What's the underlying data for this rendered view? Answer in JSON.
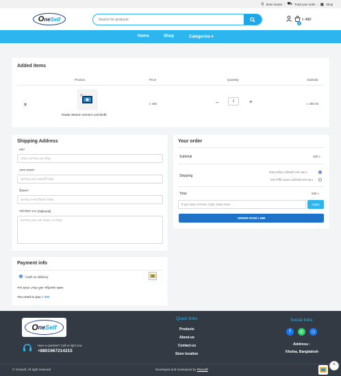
{
  "topbar": {
    "store_locator": "Store locator",
    "track_order": "Track your order",
    "shop": "Shop"
  },
  "header": {
    "logo_prefix": "O",
    "logo_mid": "ne",
    "logo_suffix": "Self",
    "search_placeholder": "Search for products",
    "cart_count": "0",
    "cart_total": "৳ 480"
  },
  "nav": {
    "home": "Home",
    "shop": "Shop",
    "categories": "Categories ▾"
  },
  "cart": {
    "title": "Added items",
    "columns": {
      "product": "Product",
      "price": "Price",
      "quantity": "Quantity",
      "subtotal": "Subtotal"
    },
    "item": {
      "remove": "✕",
      "name": "Radar Motion Sensor Led Bulb",
      "price": "৳ 480",
      "qty": "1",
      "minus": "–",
      "plus": "+",
      "subtotal": "৳ 480.00"
    }
  },
  "shipping": {
    "title": "Shipping Address",
    "name_label": "নাম*",
    "name_placeholder": "এখানে আপনার নাম লিখুন",
    "phone_label": "ফোন নাম্বার*",
    "phone_placeholder": "আপনার ফোন নাম্বারটি লিখুন",
    "address_label": "ঠিকানা*",
    "address_placeholder": "আপনার সম্পূর্ণ ঠিকানা লিখুন",
    "note_label": "অতিরিক্ত তথ্য (Optional)",
    "note_placeholder": "আপনার কোন তথ্য থাকলে তা লিখুন"
  },
  "order": {
    "title": "Your order",
    "subtotal_label": "Subtotal",
    "subtotal_value": "480 ৳",
    "shipping_label": "Shipping",
    "ship_option1": "ঢাকার বাহিরে ডেলিভারি চার্জ: 100 ৳",
    "ship_option2": "ঢাকা সিটির ভেতরে ডেলিভারি চার্জ: 60 ৳",
    "total_label": "Total",
    "total_value": "580 ৳",
    "promo_placeholder": "If you have a Promo Code, Enter Here...",
    "apply": "Apply",
    "order_button": "ORDER NOW ৳ 580"
  },
  "payment": {
    "title": "Payment info",
    "method": "Cash on delivery",
    "note": "পণ্য হাতে পেয়ে মূল্য পরিশোধ করুন",
    "pay_text": "You need to pay",
    "pay_amount": "৳ 580"
  },
  "footer": {
    "question": "Have a question? Call us right now",
    "phone": "+8801967214215",
    "quick_title": "Quick links",
    "links": [
      "Products",
      "About-us",
      "Contact-us",
      "Store location"
    ],
    "social_title": "Social links",
    "address_title": "Address :",
    "address": "Khulna, Bangladesh",
    "copyright": "© Oneself, All right reserved",
    "credit_prefix": "Developed and maintained by",
    "credit_link": "Flexsoft"
  },
  "colors": {
    "accent": "#2cb5ef",
    "brand_blue": "#1e73c8",
    "footer_bg": "#333a43"
  }
}
